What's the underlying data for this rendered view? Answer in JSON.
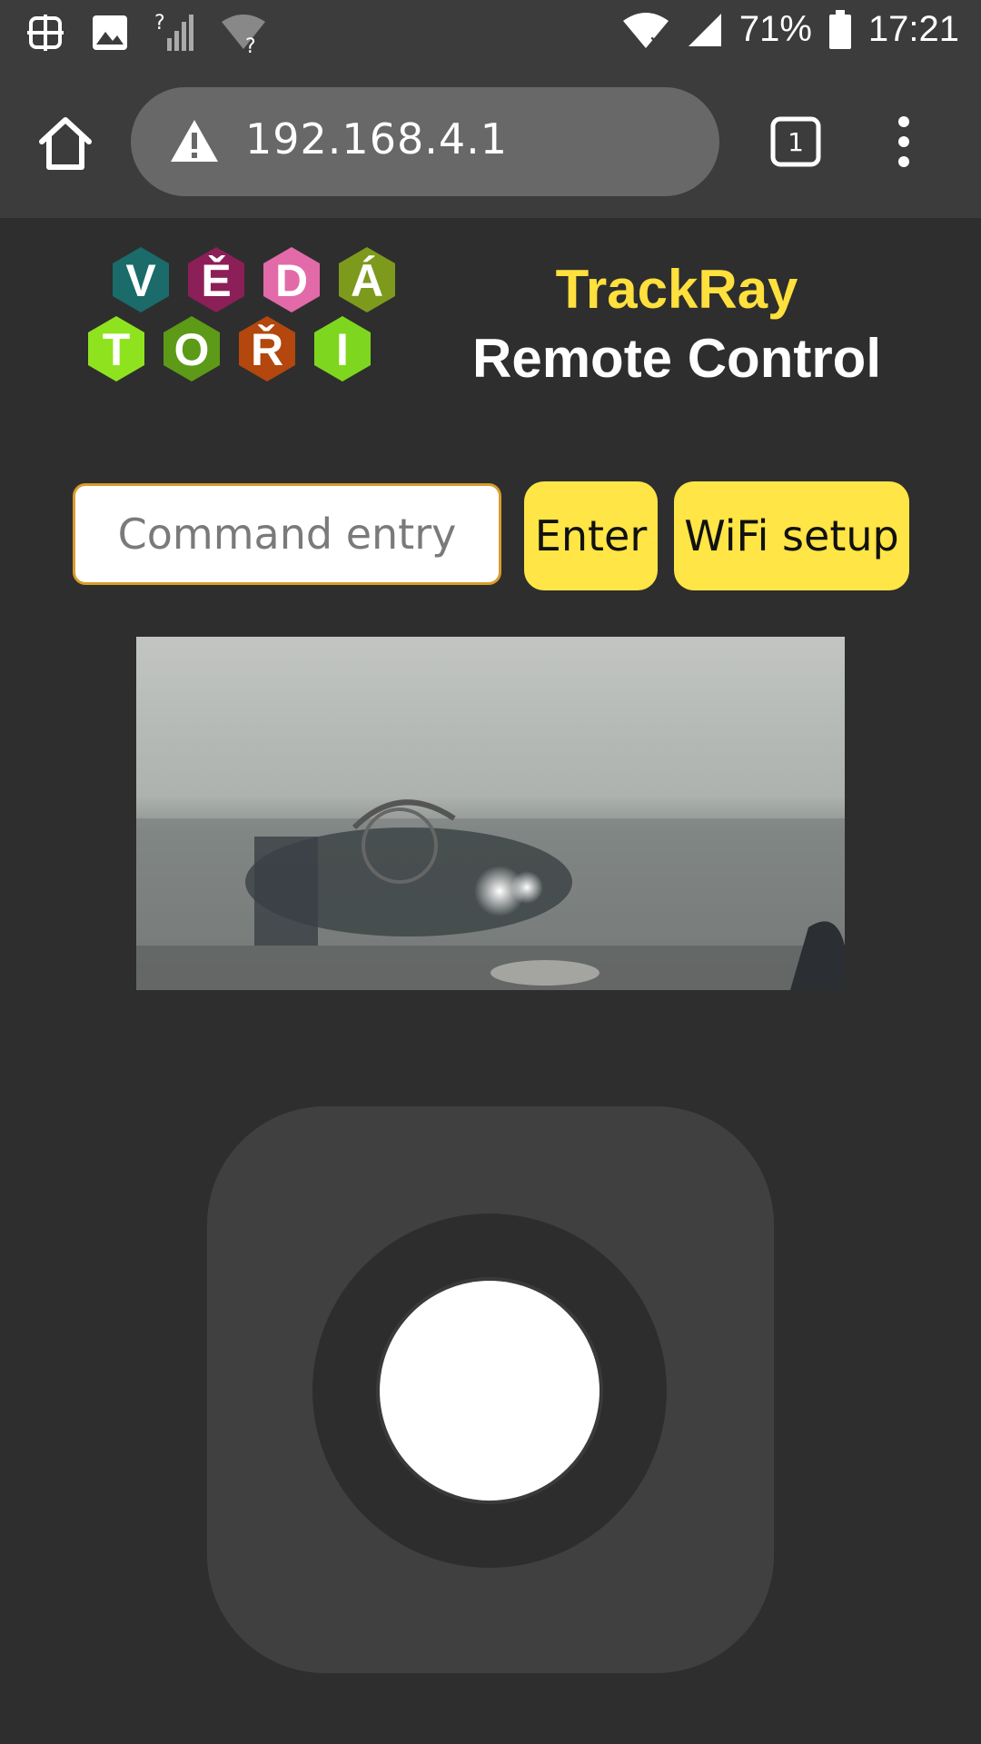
{
  "status_bar": {
    "battery_percent": "71%",
    "time": "17:21",
    "icons": [
      "screen-capture-icon",
      "image-icon",
      "signal-unknown-icon",
      "wifi-unknown-icon",
      "wifi-no-internet-icon",
      "cell-signal-icon",
      "battery-icon"
    ]
  },
  "browser": {
    "url": "192.168.4.1",
    "tab_count": "1",
    "icons": [
      "home-icon",
      "warning-icon",
      "tabs-icon",
      "more-vert-icon"
    ]
  },
  "header": {
    "logo_letters_top": [
      "V",
      "Ě",
      "D",
      "Á"
    ],
    "logo_letters_bottom": [
      "T",
      "O",
      "Ř",
      "I"
    ],
    "title": "TrackRay",
    "subtitle": "Remote Control"
  },
  "controls": {
    "command_placeholder": "Command entry",
    "enter_label": "Enter",
    "wifi_label": "WiFi setup"
  },
  "colors": {
    "background": "#2e2e2e",
    "accent_yellow": "#ffe545",
    "title_yellow": "#ffe03d",
    "input_border": "#d99c2a"
  }
}
